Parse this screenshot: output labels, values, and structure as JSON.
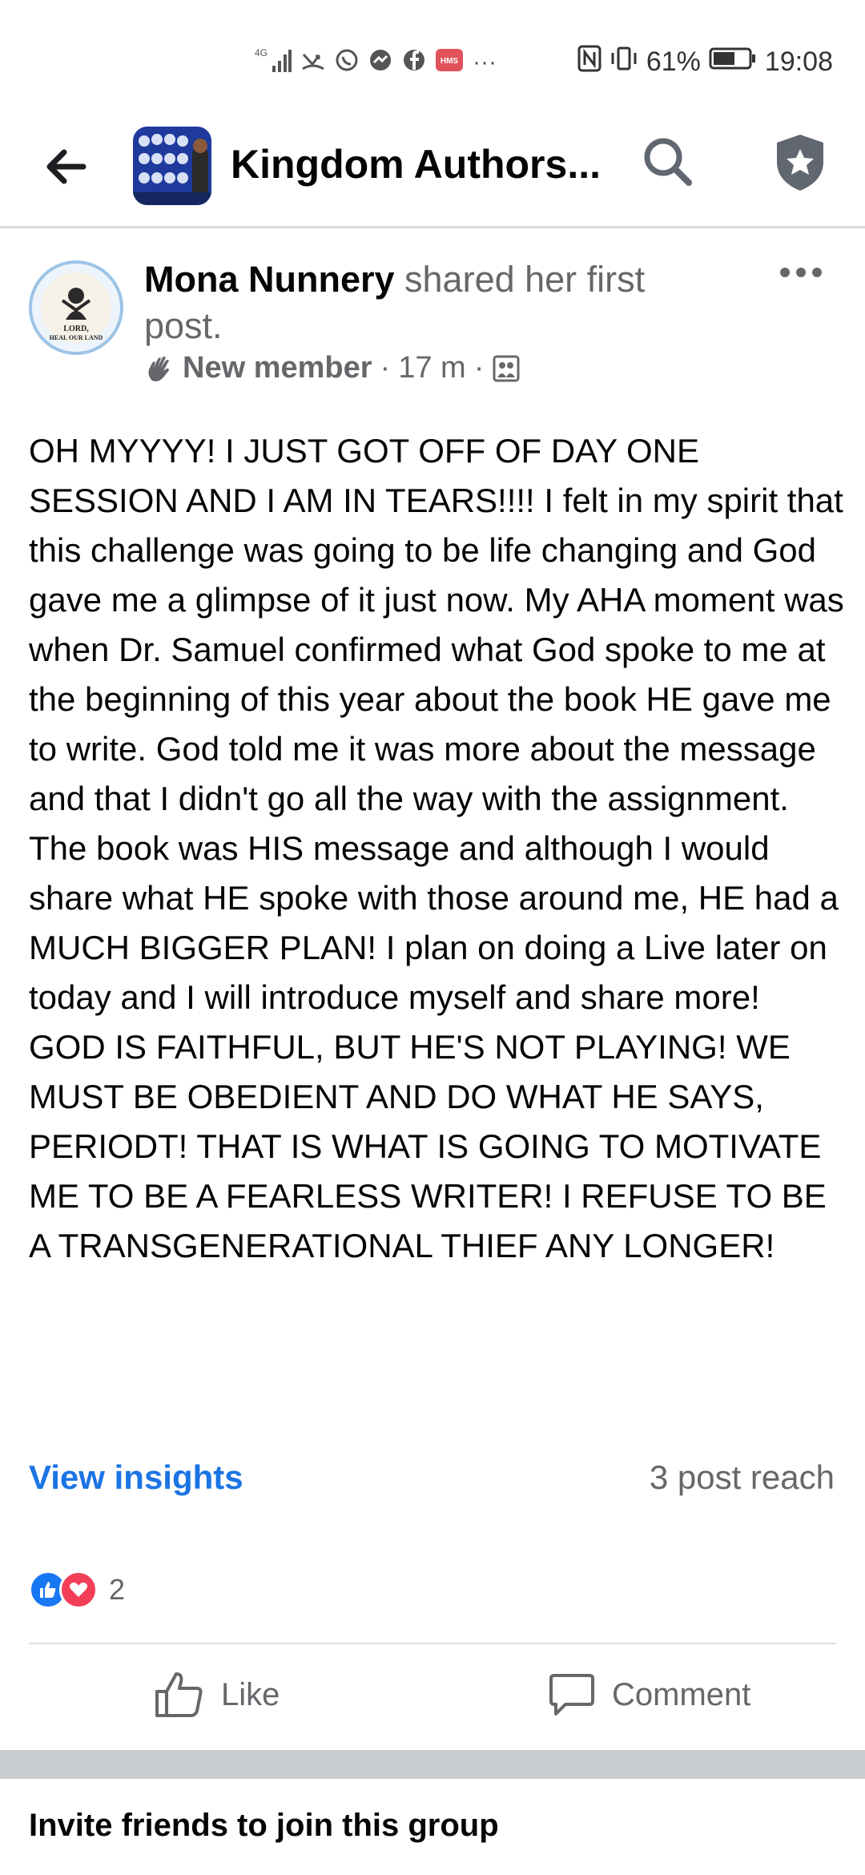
{
  "status_bar": {
    "network": "4G",
    "sim_text": "HMS",
    "more": "···",
    "battery_percent": "61%",
    "time": "19:08"
  },
  "header": {
    "group_title": "Kingdom Authors..."
  },
  "post": {
    "author_name": "Mona Nunnery",
    "action_text": " shared her first post.",
    "avatar_text": "LORD, HEAL OUR LAND",
    "badge": "New member",
    "separator": "·",
    "time_ago": "17 m",
    "body": "OH MYYYY! I JUST GOT OFF OF DAY ONE SESSION AND I AM IN TEARS!!!! I felt in my spirit that this challenge was going to be life changing and God gave me a glimpse of it just now. My AHA moment was when Dr. Samuel confirmed what God spoke to me at the beginning of this year about the book HE gave me to write. God told me it was more about the message and that I didn't go all the way with the assignment. The book was HIS message and although I would share what HE spoke with those around me, HE had a MUCH BIGGER PLAN! I plan on doing a Live later on today and I will introduce myself and share more!\nGOD IS FAITHFUL, BUT HE'S NOT PLAYING! WE MUST BE OBEDIENT AND DO WHAT HE SAYS, PERIODT! THAT IS WHAT IS GOING TO MOTIVATE ME TO BE A FEARLESS WRITER! I REFUSE TO BE A TRANSGENERATIONAL THIEF ANY LONGER!",
    "view_insights": "View insights",
    "reach": "3 post reach",
    "reaction_count": "2",
    "like_label": "Like",
    "comment_label": "Comment"
  },
  "footer": {
    "invite_text": "Invite friends to join this group"
  },
  "colors": {
    "link_blue": "#1b74e4",
    "like_blue": "#1877f2",
    "love_red": "#f33e58",
    "secondary_text": "#65676b"
  },
  "icons": {
    "back": "arrow-left-icon",
    "search": "search-icon",
    "admin": "shield-star-icon",
    "more": "more-horizontal-icon",
    "new_member": "wave-hand-icon",
    "audience": "group-audience-icon",
    "like": "thumbs-up-icon",
    "comment": "comment-bubble-icon"
  }
}
